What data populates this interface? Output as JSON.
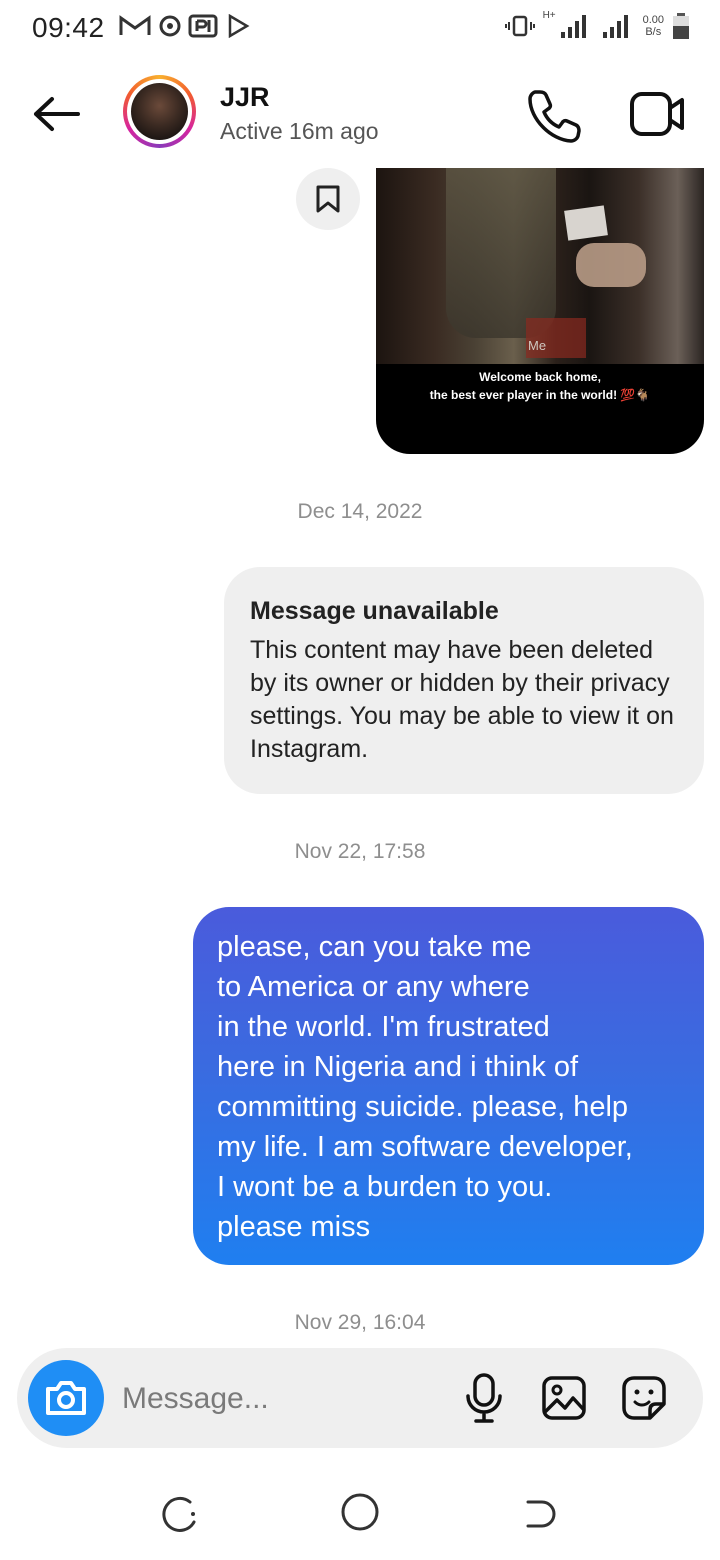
{
  "status_bar": {
    "time": "09:42",
    "net_speed_value": "0.00",
    "net_speed_unit": "B/s",
    "network_type": "H+"
  },
  "header": {
    "contact_name": "JJR",
    "contact_status": "Active 16m ago",
    "icons": [
      "back-arrow-icon",
      "phone-icon",
      "video-camera-icon"
    ]
  },
  "shared_media": {
    "tag": "Me",
    "caption_line1": "Welcome back home,",
    "caption_line2": "the best ever player in the world! 💯🐐"
  },
  "timestamps": {
    "t1": "Dec 14, 2022",
    "t2": "Nov 22, 17:58",
    "t3": "Nov 29, 16:04"
  },
  "unavailable_message": {
    "title": "Message unavailable",
    "body": "This content may have been deleted by its owner or hidden by their privacy settings. You may be able to view it on Instagram."
  },
  "sent_message": {
    "lines": [
      "please, can you take me",
      "to America or any where",
      "in the world. I'm frustrated",
      "here in Nigeria and i think of",
      "committing suicide. please, help",
      "my life. I am software developer,",
      "I wont be a burden to you.",
      "please miss"
    ]
  },
  "composer": {
    "placeholder": "Message..."
  },
  "colors": {
    "accent_blue": "#1f8ef5",
    "bubble_gradient_top": "#4a5bdc",
    "bubble_gradient_bottom": "#1f7ff0",
    "received_bubble": "#efefef"
  }
}
